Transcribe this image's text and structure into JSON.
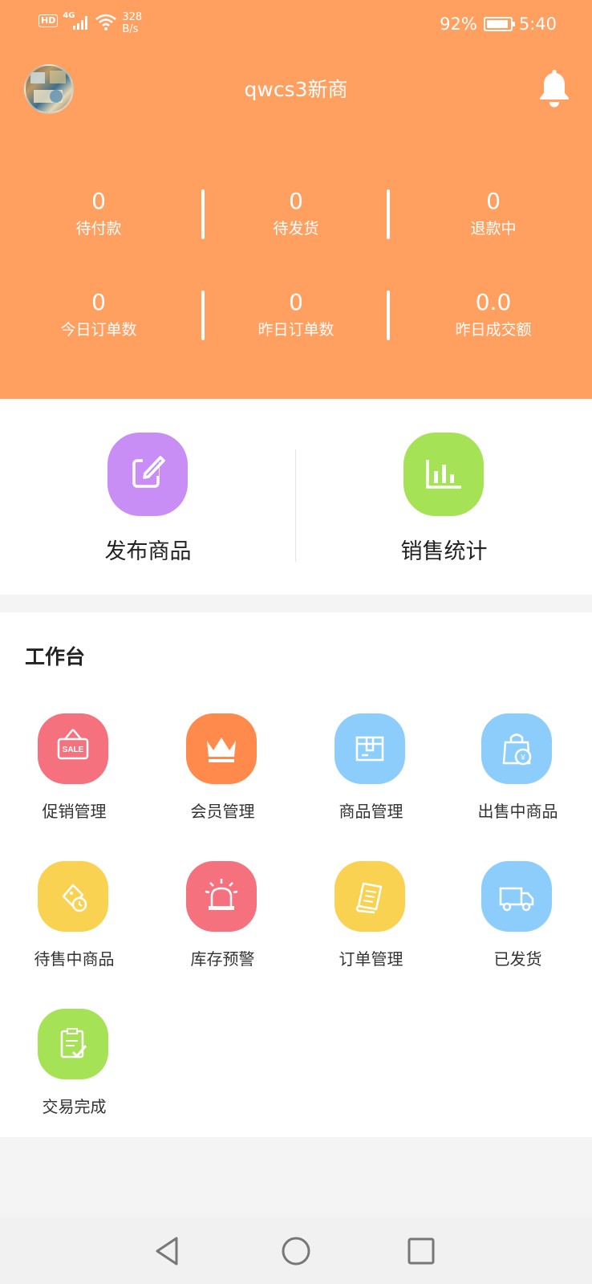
{
  "status_bar": {
    "hd": "HD",
    "network": "4G",
    "speed_value": "328",
    "speed_unit": "B/s",
    "battery_text": "92%",
    "battery_level": 0.92,
    "time": "5:40"
  },
  "header": {
    "shop_name": "qwcs3新商",
    "avatar_icon": "avatar-photo",
    "bell_icon": "bell-icon",
    "background": "#ffa061"
  },
  "stats": [
    {
      "value": "0",
      "label": "待付款"
    },
    {
      "value": "0",
      "label": "待发货"
    },
    {
      "value": "0",
      "label": "退款中"
    },
    {
      "value": "0",
      "label": "今日订单数"
    },
    {
      "value": "0",
      "label": "昨日订单数"
    },
    {
      "value": "0.0",
      "label": "昨日成交额"
    }
  ],
  "quick_actions": [
    {
      "label": "发布商品",
      "icon": "edit-icon",
      "color": "#c88ef5"
    },
    {
      "label": "销售统计",
      "icon": "bar-chart-icon",
      "color": "#a6e255"
    }
  ],
  "workbench": {
    "title": "工作台",
    "items": [
      {
        "label": "促销管理",
        "icon": "sale-sign-icon",
        "color": "#f6717e"
      },
      {
        "label": "会员管理",
        "icon": "crown-icon",
        "color": "#ff8a4c"
      },
      {
        "label": "商品管理",
        "icon": "box-icon",
        "color": "#8dcdfb"
      },
      {
        "label": "出售中商品",
        "icon": "shopping-bag-icon",
        "color": "#8dcdfb"
      },
      {
        "label": "待售中商品",
        "icon": "tag-clock-icon",
        "color": "#fad251"
      },
      {
        "label": "库存预警",
        "icon": "alarm-light-icon",
        "color": "#f6717e"
      },
      {
        "label": "订单管理",
        "icon": "receipt-icon",
        "color": "#fad251"
      },
      {
        "label": "已发货",
        "icon": "truck-icon",
        "color": "#8dcdfb"
      },
      {
        "label": "交易完成",
        "icon": "checklist-icon",
        "color": "#a6e255"
      }
    ]
  },
  "nav": {
    "back_icon": "back-triangle-icon",
    "home_icon": "home-circle-icon",
    "recent_icon": "recent-square-icon"
  }
}
